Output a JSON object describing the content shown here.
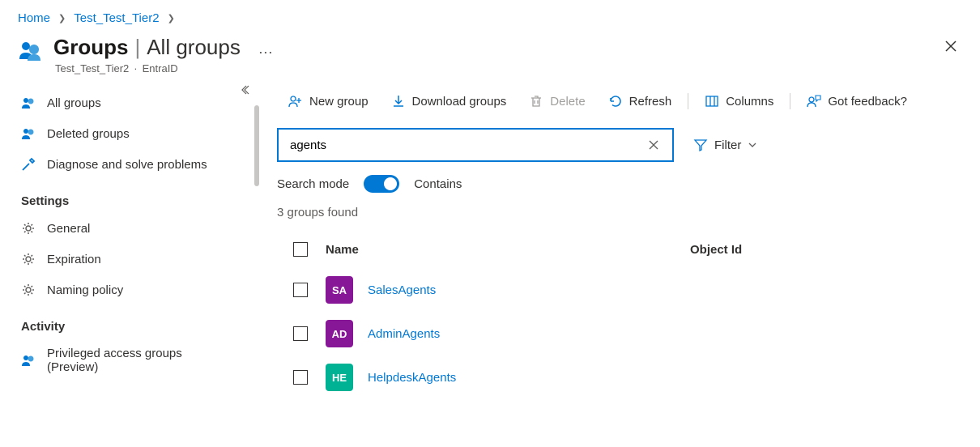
{
  "breadcrumb": {
    "home": "Home",
    "tenant": "Test_Test_Tier2"
  },
  "header": {
    "title": "Groups",
    "subtitle": "All groups",
    "tenant": "Test_Test_Tier2",
    "service": "EntraID"
  },
  "sidebar": {
    "all_groups": "All groups",
    "deleted_groups": "Deleted groups",
    "diagnose": "Diagnose and solve problems",
    "section_settings": "Settings",
    "general": "General",
    "expiration": "Expiration",
    "naming_policy": "Naming policy",
    "section_activity": "Activity",
    "privileged": "Privileged access groups (Preview)"
  },
  "toolbar": {
    "new_group": "New group",
    "download": "Download groups",
    "delete": "Delete",
    "refresh": "Refresh",
    "columns": "Columns",
    "feedback": "Got feedback?"
  },
  "search": {
    "value": "agents",
    "filter_label": "Filter",
    "mode_label": "Search mode",
    "mode_value": "Contains"
  },
  "results": {
    "count_text": "3 groups found",
    "columns": {
      "name": "Name",
      "object_id": "Object Id"
    },
    "groups": [
      {
        "initials": "SA",
        "name": "SalesAgents",
        "color": "purple"
      },
      {
        "initials": "AD",
        "name": "AdminAgents",
        "color": "purple"
      },
      {
        "initials": "HE",
        "name": "HelpdeskAgents",
        "color": "teal"
      }
    ]
  }
}
